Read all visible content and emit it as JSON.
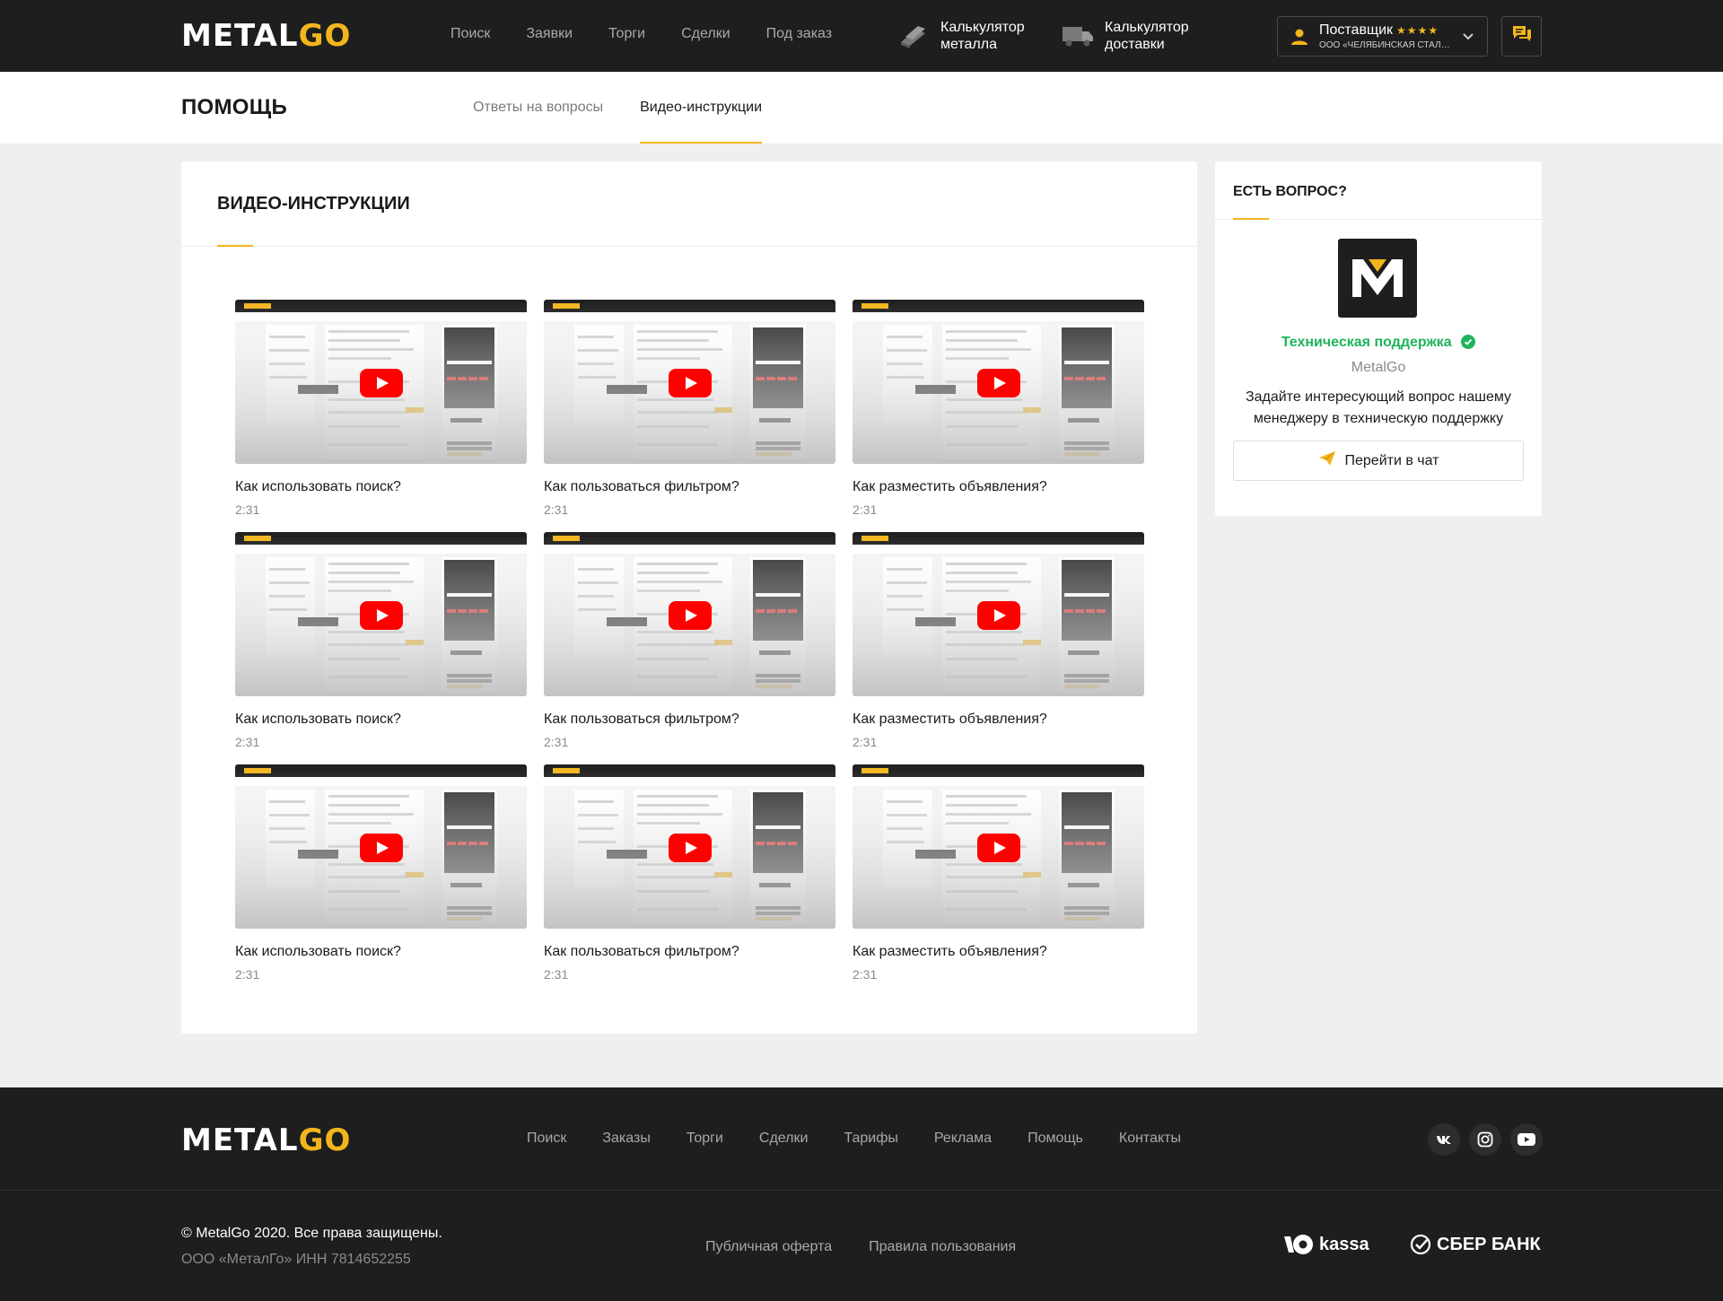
{
  "brand": {
    "logo_white": "METAL",
    "logo_yellow": "GO"
  },
  "header": {
    "nav": [
      "Поиск",
      "Заявки",
      "Торги",
      "Сделки",
      "Под заказ"
    ],
    "calc_metal": [
      "Калькулятор",
      "металла"
    ],
    "calc_delivery": [
      "Калькулятор",
      "доставки"
    ],
    "supplier": {
      "role": "Поставщик",
      "stars": "★★★★",
      "org": "ООО «ЧЕЛЯБИНСКАЯ СТАЛЬН..."
    }
  },
  "subheader": {
    "title": "ПОМОЩЬ",
    "tabs": [
      "Ответы на вопросы",
      "Видео-инструкции"
    ],
    "active_tab": 1
  },
  "main": {
    "title": "ВИДЕО-ИНСТРУКЦИИ",
    "videos": [
      {
        "title": "Как использовать поиск?",
        "duration": "2:31"
      },
      {
        "title": "Как пользоваться фильтром?",
        "duration": "2:31"
      },
      {
        "title": "Как разместить объявления?",
        "duration": "2:31"
      },
      {
        "title": "Как использовать поиск?",
        "duration": "2:31"
      },
      {
        "title": "Как пользоваться фильтром?",
        "duration": "2:31"
      },
      {
        "title": "Как разместить объявления?",
        "duration": "2:31"
      },
      {
        "title": "Как использовать поиск?",
        "duration": "2:31"
      },
      {
        "title": "Как пользоваться фильтром?",
        "duration": "2:31"
      },
      {
        "title": "Как разместить объявления?",
        "duration": "2:31"
      }
    ]
  },
  "sidebar": {
    "title": "ЕСТЬ ВОПРОС?",
    "support_name": "Техническая поддержка",
    "support_sub": "MetalGo",
    "text": "Задайте интересующий вопрос нашему менеджеру в техническую поддержку",
    "chat_button": "Перейти в чат"
  },
  "footer": {
    "nav": [
      "Поиск",
      "Заказы",
      "Торги",
      "Сделки",
      "Тарифы",
      "Реклама",
      "Помощь",
      "Контакты"
    ],
    "social_icons": [
      "vk-icon",
      "instagram-icon",
      "youtube-icon"
    ],
    "copyright": "© MetalGo 2020. Все права защищены.",
    "inn": "ООО «МеталГо» ИНН 7814652255",
    "links": [
      "Публичная оферта",
      "Правила пользования"
    ],
    "pay1": "kassa",
    "pay2": "СБЕР БАНК"
  },
  "colors": {
    "accent": "#f2b51c",
    "dark": "#1e1e1e",
    "success": "#1fb45c",
    "play": "#ff0000"
  }
}
